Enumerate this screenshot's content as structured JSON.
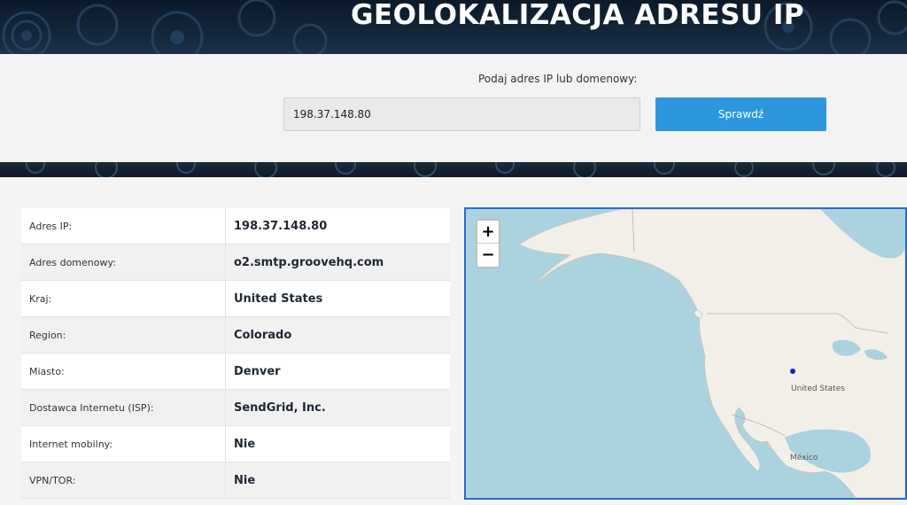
{
  "header": {
    "title": "GEOLOKALIZACJA ADRESU IP"
  },
  "search": {
    "label": "Podaj adres IP lub domenowy:",
    "value": "198.37.148.80",
    "button_label": "Sprawdź"
  },
  "info": {
    "rows": [
      {
        "label": "Adres IP:",
        "value": "198.37.148.80"
      },
      {
        "label": "Adres domenowy:",
        "value": "o2.smtp.groovehq.com"
      },
      {
        "label": "Kraj:",
        "value": "United States"
      },
      {
        "label": "Region:",
        "value": "Colorado"
      },
      {
        "label": "Miasto:",
        "value": "Denver"
      },
      {
        "label": "Dostawca Internetu (ISP):",
        "value": "SendGrid, Inc."
      },
      {
        "label": "Internet mobilny:",
        "value": "Nie"
      },
      {
        "label": "VPN/TOR:",
        "value": "Nie"
      }
    ]
  },
  "map": {
    "zoom_in": "+",
    "zoom_out": "−",
    "label_us": "United States",
    "label_mexico": "México",
    "colors": {
      "water": "#aad3df",
      "land": "#f2efe9",
      "border": "#b8a8c0",
      "marker": "#1a1adf",
      "frame": "#2868d6"
    }
  },
  "colors": {
    "accent_button": "#2c97de",
    "banner": "#13263a"
  }
}
